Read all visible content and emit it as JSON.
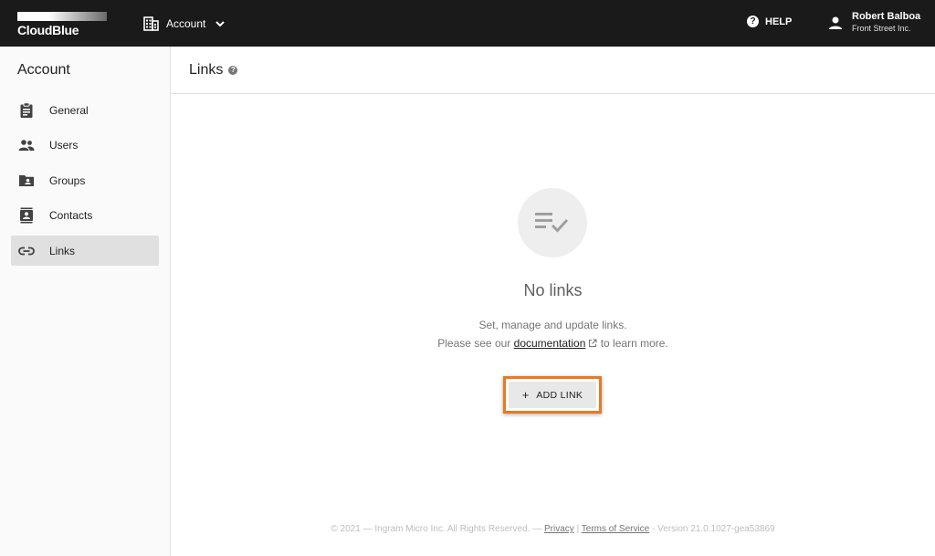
{
  "brand": {
    "logo_text": "CloudBlue"
  },
  "header": {
    "account_switch_label": "Account",
    "help_label": "HELP",
    "user_name": "Robert Balboa",
    "user_org": "Front Street Inc."
  },
  "sidebar": {
    "title": "Account",
    "items": [
      {
        "label": "General",
        "icon": "clipboard-icon"
      },
      {
        "label": "Users",
        "icon": "people-icon"
      },
      {
        "label": "Groups",
        "icon": "folder-account-icon"
      },
      {
        "label": "Contacts",
        "icon": "contact-card-icon"
      },
      {
        "label": "Links",
        "icon": "link-icon",
        "active": true
      }
    ]
  },
  "main": {
    "title": "Links",
    "empty": {
      "title": "No links",
      "desc_line1": "Set, manage and update links.",
      "desc_line2_prefix": "Please see our",
      "doc_link": "documentation",
      "desc_line2_suffix": "to learn more."
    },
    "add_button": {
      "icon": "+",
      "label": "ADD LINK"
    }
  },
  "footer": {
    "copyright": "© 2021 — Ingram Micro Inc. All Rights Reserved. —",
    "privacy": "Privacy",
    "separator": "|",
    "terms": "Terms of Service",
    "version": "- Version 21.0.1027-gea53869"
  },
  "colors": {
    "topbar": "#1a1a1a",
    "highlight": "#e87a22",
    "active_nav": "#e0e0e0"
  }
}
